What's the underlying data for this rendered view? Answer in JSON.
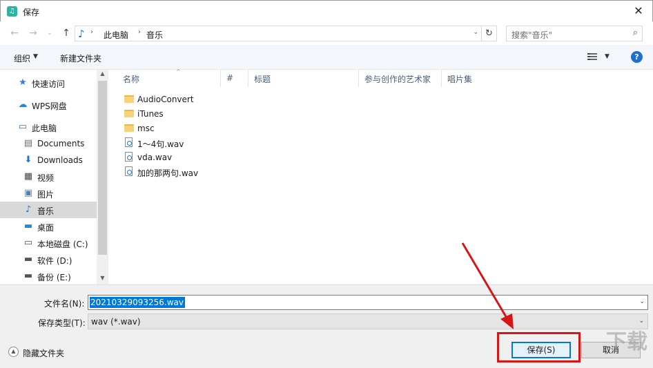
{
  "window": {
    "title": "保存",
    "app_icon": "music-note-icon",
    "close_glyph": "✕"
  },
  "nav": {
    "back_glyph": "←",
    "forward_glyph": "→",
    "recent_glyph": "⌄",
    "up_glyph": "↑",
    "path": [
      "此电脑",
      "音乐"
    ],
    "path_icon": "♪",
    "refresh_glyph": "↻",
    "search_placeholder": "搜索\"音乐\"",
    "search_glyph": "⌕"
  },
  "toolbar": {
    "organize": "组织",
    "new_folder": "新建文件夹",
    "help": "?"
  },
  "sidebar": {
    "items": [
      {
        "label": "快速访问",
        "icon": "★",
        "color": "#2f7fd6"
      },
      {
        "label": "WPS网盘",
        "icon": "☁",
        "color": "#2f7fd6"
      },
      {
        "label": "此电脑",
        "icon": "▭",
        "color": "#2b7ad0"
      },
      {
        "label": "Documents",
        "icon": "▤",
        "color": "#6b6b6b"
      },
      {
        "label": "Downloads",
        "icon": "⬇",
        "color": "#2b6fc7"
      },
      {
        "label": "视频",
        "icon": "▦",
        "color": "#444444"
      },
      {
        "label": "图片",
        "icon": "▣",
        "color": "#5b7ea3"
      },
      {
        "label": "音乐",
        "icon": "♪",
        "color": "#1e73d0"
      },
      {
        "label": "桌面",
        "icon": "▬",
        "color": "#1f8ad6"
      },
      {
        "label": "本地磁盘 (C:)",
        "icon": "▭",
        "color": "#555555"
      },
      {
        "label": "软件 (D:)",
        "icon": "▬",
        "color": "#555555"
      },
      {
        "label": "备份 (E:)",
        "icon": "▬",
        "color": "#555555"
      }
    ],
    "selected": "音乐",
    "scroll_up": "▲",
    "scroll_down": "▼"
  },
  "columns": [
    "名称",
    "#",
    "标题",
    "参与创作的艺术家",
    "唱片集"
  ],
  "sort_glyph": "^",
  "files": [
    {
      "name": "AudioConvert",
      "type": "folder"
    },
    {
      "name": "iTunes",
      "type": "folder"
    },
    {
      "name": "msc",
      "type": "folder"
    },
    {
      "name": "1～4句.wav",
      "type": "wav"
    },
    {
      "name": "vda.wav",
      "type": "wav"
    },
    {
      "name": "加的那两句.wav",
      "type": "wav"
    }
  ],
  "form": {
    "filename_label": "文件名(N):",
    "filename_value": "20210329093256.wav",
    "type_label": "保存类型(T):",
    "type_value": "wav (*.wav)",
    "dropdown_glyph": "⌄"
  },
  "footer": {
    "hide_folders": "隐藏文件夹",
    "hide_glyph": "▲",
    "save": "保存(S)",
    "cancel": "取消"
  },
  "annotation": {
    "arrow_color": "#d81515"
  }
}
